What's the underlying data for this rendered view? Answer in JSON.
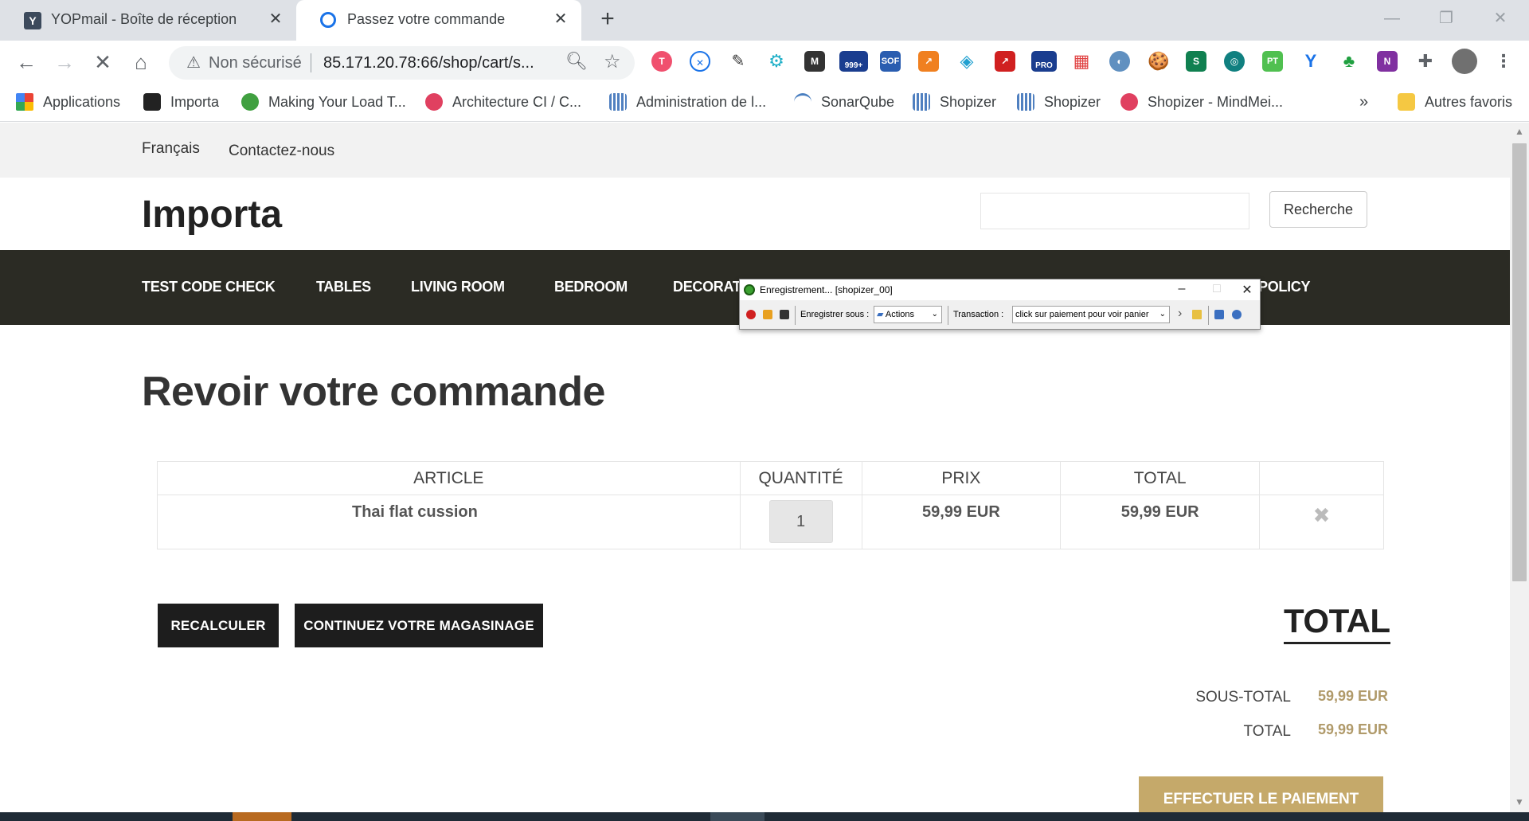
{
  "browser": {
    "tabs": [
      {
        "title": "YOPmail - Boîte de réception",
        "favicon": "Y"
      },
      {
        "title": "Passez votre commande"
      }
    ],
    "address": {
      "security_label": "Non sécurisé",
      "url": "85.171.20.78:66/shop/cart/s..."
    },
    "extension_badges": {
      "badge_999": "999+",
      "badge_pro": "PRO",
      "badge_sof": "SOF",
      "badge_pt": "PT"
    },
    "bookmarks": [
      {
        "label": "Applications"
      },
      {
        "label": "Importa"
      },
      {
        "label": "Making Your Load T..."
      },
      {
        "label": "Architecture CI / C..."
      },
      {
        "label": "Administration de l..."
      },
      {
        "label": "SonarQube"
      },
      {
        "label": "Shopizer"
      },
      {
        "label": "Shopizer"
      },
      {
        "label": "Shopizer - MindMei..."
      }
    ],
    "bookmarks_overflow": "»",
    "other_bookmarks": "Autres favoris"
  },
  "site": {
    "topbar": {
      "language": "Français",
      "contact": "Contactez-nous"
    },
    "brand": "Importa",
    "search_button": "Recherche",
    "nav": [
      "TEST CODE CHECK",
      "TABLES",
      "LIVING ROOM",
      "BEDROOM",
      "DECORAT",
      "POLICY"
    ]
  },
  "cart": {
    "title": "Revoir votre commande",
    "headers": [
      "ARTICLE",
      "QUANTITÉ",
      "PRIX",
      "TOTAL"
    ],
    "rows": [
      {
        "article": "Thai flat cussion",
        "quantity": "1",
        "price": "59,99 EUR",
        "total": "59,99 EUR"
      }
    ],
    "recalc_label": "RECALCULER",
    "continue_label": "CONTINUEZ VOTRE MAGASINAGE",
    "total_heading": "TOTAL",
    "subtotal_label": "SOUS-TOTAL",
    "subtotal_value": "59,99 EUR",
    "total_label": "TOTAL",
    "total_value": "59,99 EUR",
    "pay_label": "EFFECTUER LE PAIEMENT"
  },
  "recorder": {
    "title": "Enregistrement... [shopizer_00]",
    "save_as_label": "Enregistrer sous :",
    "save_as_value": "Actions",
    "transaction_label": "Transaction :",
    "transaction_value": "click sur paiement pour voir panier"
  },
  "colors": {
    "nav_bg": "#2b2b24",
    "pay_button": "#c5a96a",
    "price_accent": "#b09a6a"
  }
}
